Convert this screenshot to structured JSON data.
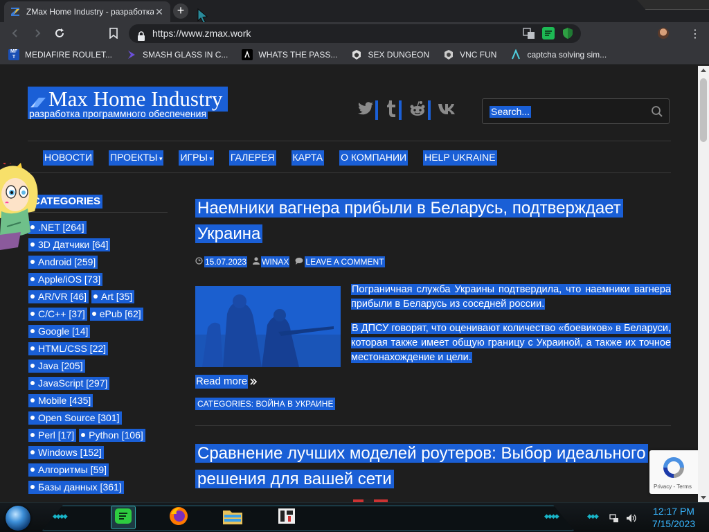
{
  "browser": {
    "tab_title": "ZMax Home Industry - разработка программного обеспечения",
    "tab_close": "✕",
    "new_tab": "+",
    "url": "https://www.zmax.work",
    "menu": "⋮",
    "bookmarks": [
      {
        "label": "MEDIAFIRE ROULET...",
        "icon": "mediafire-icon"
      },
      {
        "label": "SMASH GLASS IN C...",
        "icon": "smash-icon"
      },
      {
        "label": "WHATS THE PASS...",
        "icon": "whats-icon"
      },
      {
        "label": "SEX DUNGEON",
        "icon": "dungeon-icon"
      },
      {
        "label": "VNC FUN",
        "icon": "vnc-icon"
      },
      {
        "label": "captcha solving sim...",
        "icon": "captcha-icon"
      }
    ]
  },
  "site": {
    "title": "Max Home Industry",
    "subtitle": "разработка программного обеспечения",
    "search_placeholder": "Search...",
    "nav": [
      {
        "label": "НОВОСТИ",
        "caret": false
      },
      {
        "label": "ПРОЕКТЫ",
        "caret": true
      },
      {
        "label": "ИГРЫ",
        "caret": true
      },
      {
        "label": "ГАЛЕРЕЯ",
        "caret": false
      },
      {
        "label": "КАРТА",
        "caret": false
      },
      {
        "label": "О КОМПАНИИ",
        "caret": false
      },
      {
        "label": "HELP UKRAINE",
        "caret": false
      }
    ]
  },
  "sidebar": {
    "heading": "CATEGORIES",
    "rows": [
      [
        ".NET [264]"
      ],
      [
        "3D Датчики [64]"
      ],
      [
        "Android [259]"
      ],
      [
        "Apple/iOS [73]"
      ],
      [
        "AR/VR [46]",
        "Art [35]"
      ],
      [
        "C/C++ [37]",
        "ePub [62]"
      ],
      [
        "Google [14]"
      ],
      [
        "HTML/CSS [22]"
      ],
      [
        "Java [205]"
      ],
      [
        "JavaScript [297]"
      ],
      [
        "Mobile [435]"
      ],
      [
        "Open Source [301]"
      ],
      [
        "Perl [17]",
        "Python [106]"
      ],
      [
        "Windows [152]"
      ],
      [
        "Алгоритмы [59]"
      ],
      [
        "Базы данных [361]"
      ]
    ]
  },
  "posts": [
    {
      "title_lines": [
        "Наемники вагнера прибыли в Беларусь, подтверждает",
        "Украина"
      ],
      "date": "15.07.2023",
      "author": "WINAX",
      "comments": "LEAVE A COMMENT",
      "paragraphs": [
        "Пограничная служба Украины подтвердила, что наемники вагнера прибыли в Беларусь из соседней россии.",
        "В ДПСУ говорят, что оценивают количество «боевиков» в Беларуси, которая также имеет общую границу с Украиной, а также их точное местонахождение и цели."
      ],
      "read_more": "Read more",
      "categories": "CATEGORIES: ВОЙНА В УКРАИНЕ"
    },
    {
      "title_lines": [
        "Сравнение лучших моделей роутеров: Выбор идеального",
        "решения для вашей сети"
      ]
    }
  ],
  "recaptcha": {
    "terms": "Privacy - Terms"
  },
  "taskbar": {
    "time": "12:17 PM",
    "date": "7/15/2023"
  },
  "colors": {
    "selection": "#1a5fd6",
    "page_bg": "#1e1e1e",
    "clock": "#38b6ff",
    "accent_cyan": "#19b5c8"
  }
}
